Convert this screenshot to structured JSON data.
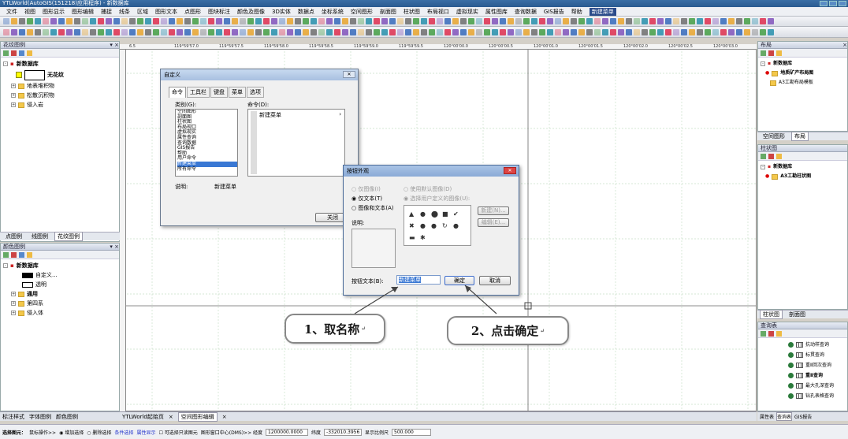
{
  "window": {
    "title": "YTLWorld(AutoGIS(151218)应用程序) - 新数据库"
  },
  "menubar": {
    "items": [
      "文件",
      "视图",
      "图形显示",
      "图形编辑",
      "捕捉",
      "线条",
      "区域",
      "图形文本",
      "点图形",
      "图块标注",
      "颜色及图像",
      "3D实体",
      "数据点",
      "坐标系统",
      "空间图形",
      "剖面图",
      "柱状图",
      "布局视口",
      "虚拟现实",
      "属性图库",
      "查询数据",
      "GIS报告",
      "帮助",
      "新建菜单"
    ]
  },
  "left_panel": {
    "title": "花纹图例",
    "root": "新数据库",
    "items": [
      "无花纹",
      "地表堆积物",
      "松散沉积物",
      "侵入岩"
    ],
    "tabs": [
      "点图例",
      "线图例",
      "花纹图例"
    ]
  },
  "color_panel": {
    "title": "颜色图例",
    "root": "新数据库",
    "items": [
      "自定义...",
      "透明",
      "通用",
      "第四系",
      "侵入体"
    ],
    "tabs": [
      "标注样式",
      "字体图例",
      "颜色图例"
    ]
  },
  "map_tabs": [
    "YTLWorld起始页",
    "空间图形编辑"
  ],
  "ruler": {
    "labels": [
      "6.5",
      "119°59'57.0",
      "119°59'57.5",
      "119°59'58.0",
      "119°59'58.5",
      "119°59'59.0",
      "119°59'59.5",
      "120°00'00.0",
      "120°00'00.5",
      "120°00'01.0",
      "120°00'01.5",
      "120°00'02.0",
      "120°00'02.5",
      "120°00'03.0"
    ]
  },
  "customize_dialog": {
    "title": "自定义",
    "tabs": [
      "命令",
      "工具栏",
      "键盘",
      "菜单",
      "选项"
    ],
    "category_label": "类别(G):",
    "categories": [
      "空间图形",
      "剖面图",
      "柱状图",
      "布局视口",
      "虚拟现实",
      "属性查询",
      "查询数据",
      "GIS报告",
      "帮助",
      "用户命令",
      "新建菜单",
      "所有命令"
    ],
    "selected_category": "新建菜单",
    "command_label": "命令(D):",
    "commands": [
      "新建菜单"
    ],
    "desc_label": "说明:",
    "desc_value": "新建菜单",
    "close_button": "关闭"
  },
  "button_dialog": {
    "title": "按钮外观",
    "radio_image_only": "仅图像(I)",
    "radio_text_only": "仅文本(T)",
    "radio_image_text": "图像和文本(A)",
    "radio_default_image": "使用默认图像(D)",
    "radio_user_image": "选择用户定义的图像(U):",
    "new_button": "新建(N)...",
    "edit_button": "编辑(E)...",
    "desc_label": "说明:",
    "button_text_label": "按钮文本(B):",
    "button_text_value": "新建菜单",
    "ok_button": "确定",
    "cancel_button": "取消"
  },
  "callouts": {
    "step1": "1、取名称",
    "step2": "2、点击确定"
  },
  "right_top": {
    "title": "布局",
    "root": "新数据库",
    "items": [
      "地质矿产布局图",
      "A3工勘布局模板"
    ],
    "tabs": [
      "空间图形",
      "布局"
    ]
  },
  "right_mid": {
    "title": "柱状图",
    "root": "新数据库",
    "items": [
      "A3工勘柱状图"
    ],
    "tabs": [
      "柱状图",
      "剖面图"
    ]
  },
  "right_bottom": {
    "title": "查询表",
    "items": [
      "抗动样查询",
      "标贯查询",
      "重Ⅱ回次查询",
      "重Ⅱ查询",
      "最大孔深查询",
      "钻孔表格查询"
    ],
    "tabs": [
      "属性表",
      "查询表",
      "GIS报告"
    ]
  },
  "status": {
    "select_label": "选择图元：",
    "mouse_op": "鼠标操作>>",
    "add_select": "增加选择",
    "del_select": "删除选择",
    "cond_select": "条件选择",
    "attr_display": "属性显示",
    "locked": "可选择只读图元",
    "center_label": "图形窗口中心(DMS)>> 经度",
    "lon": "1200000.0000",
    "lat_label": "纬度",
    "lat": "-332010.3956",
    "scale_label": "显示比例尺",
    "scale": "500.000"
  }
}
